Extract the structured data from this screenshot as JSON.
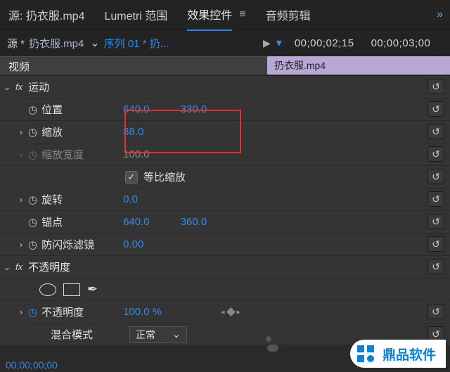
{
  "top": {
    "source_tab": "源: 扔衣服.mp4",
    "lumetri_tab": "Lumetri 范围",
    "effects_tab": "效果控件",
    "audio_tab": "音频剪辑",
    "more": "»"
  },
  "sub": {
    "src_prefix": "源 *",
    "src_name": "扔衣服.mp4",
    "seq_name": "序列 01 * 扔..."
  },
  "timeline": {
    "tc1": "00;00;02;15",
    "tc2": "00;00;03;00",
    "clip_name": "扔衣服.mp4"
  },
  "panel": {
    "video": "视频"
  },
  "motion": {
    "fx": "fx",
    "name": "运动",
    "position_label": "位置",
    "position_x": "640.0",
    "position_y": "330.0",
    "scale_label": "缩放",
    "scale_val": "88.0",
    "scale_w_label": "缩放宽度",
    "scale_w_val": "100.0",
    "uniform_label": "等比缩放",
    "rotation_label": "旋转",
    "rotation_val": "0.0",
    "anchor_label": "锚点",
    "anchor_x": "640.0",
    "anchor_y": "360.0",
    "flicker_label": "防闪烁滤镜",
    "flicker_val": "0.00"
  },
  "opacity": {
    "fx": "fx",
    "name": "不透明度",
    "opacity_label": "不透明度",
    "opacity_val": "100.0 %",
    "blend_label": "混合模式",
    "blend_val": "正常"
  },
  "footer": {
    "time": "00;00;00;00"
  },
  "watermark": {
    "text": "鼎品软件"
  }
}
